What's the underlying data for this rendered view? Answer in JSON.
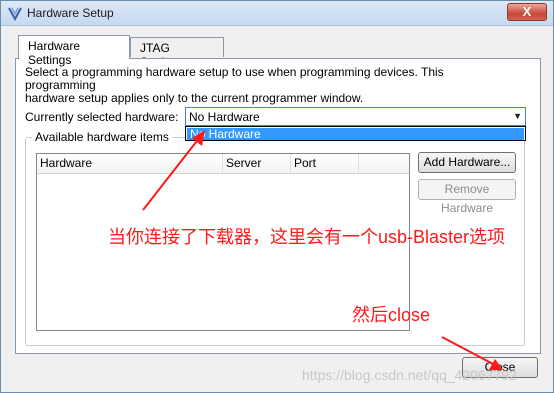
{
  "window": {
    "title": "Hardware Setup",
    "close_glyph": "X"
  },
  "tabs": [
    {
      "label": "Hardware Settings",
      "active": true
    },
    {
      "label": "JTAG Settings",
      "active": false
    }
  ],
  "hardware_settings": {
    "description_line1": "Select a programming hardware setup to use when programming devices. This programming",
    "description_line2": "hardware setup applies only to the current programmer window.",
    "current_label": "Currently selected hardware:",
    "current_value": "No Hardware",
    "dropdown_options": [
      "No Hardware"
    ],
    "available_group_title": "Available hardware items",
    "columns": [
      "Hardware",
      "Server",
      "Port"
    ],
    "add_button": "Add Hardware...",
    "remove_button": "Remove Hardware"
  },
  "footer": {
    "close_button": "Close"
  },
  "annotations": {
    "text1": "当你连接了下载器，这里会有一个usb-Blaster选项",
    "text2": "然后close",
    "color": "#ff1a1a"
  },
  "watermark": "https://blog.csdn.net/qq_42067792"
}
